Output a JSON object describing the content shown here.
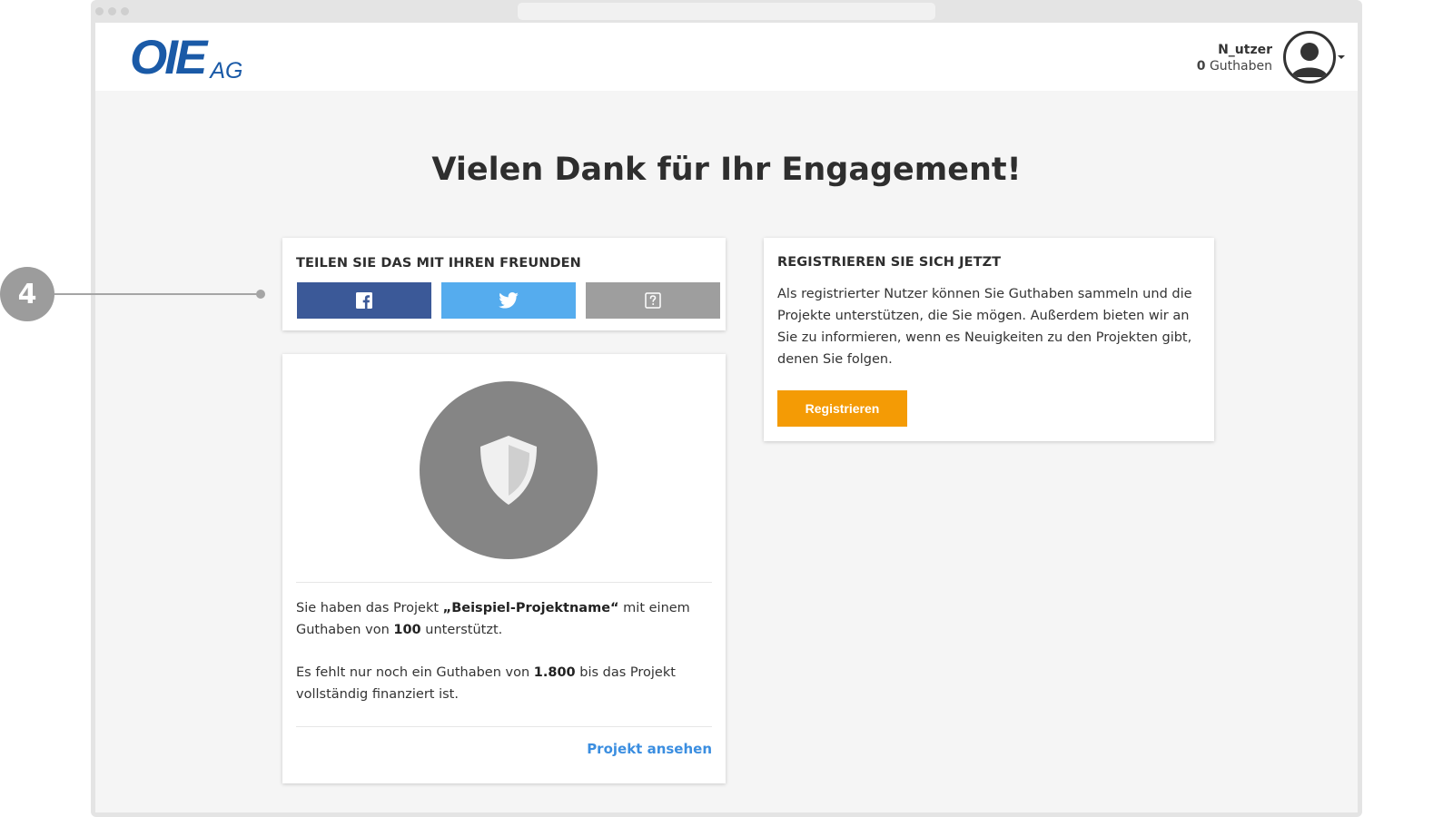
{
  "logo": {
    "main": "OIE",
    "sub": "AG"
  },
  "user": {
    "name": "N_utzer",
    "credits_value": "0",
    "credits_label": "Guthaben"
  },
  "page_title": "Vielen Dank für Ihr Engagement!",
  "share": {
    "heading": "TEILEN SIE DAS MIT IHREN FREUNDEN",
    "buttons": [
      {
        "icon": "facebook-icon",
        "color": "#3b5998"
      },
      {
        "icon": "twitter-icon",
        "color": "#55acee"
      },
      {
        "icon": "help-icon",
        "color": "#9e9e9e"
      }
    ]
  },
  "project": {
    "icon": "shield-icon",
    "p1_a": "Sie haben das Projekt ",
    "p1_name": "„Beispiel-Projektname“",
    "p1_b": " mit einem Guthaben von ",
    "p1_amount": "100",
    "p1_c": " unterstützt.",
    "p2_a": "Es fehlt nur noch ein Guthaben von ",
    "p2_amount": "1.800",
    "p2_b": " bis das Projekt vollständig finanziert ist.",
    "link_label": "Projekt ansehen"
  },
  "register": {
    "heading": "REGISTRIEREN SIE SICH JETZT",
    "text": "Als registrierter Nutzer können Sie Guthaben sammeln und die Projekte unterstützen, die Sie mögen. Außerdem bieten wir an Sie zu informieren, wenn es Neuigkeiten zu den Projekten gibt, denen Sie folgen.",
    "button_label": "Registrieren",
    "button_color": "#f49b05"
  },
  "callout": {
    "number": "4"
  }
}
